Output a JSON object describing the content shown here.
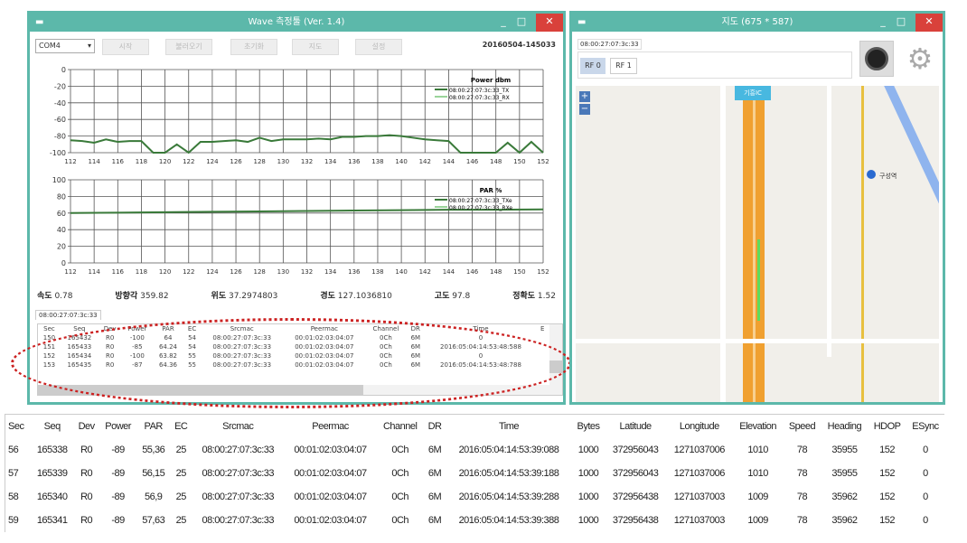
{
  "main_window": {
    "title": "Wave 측정툴 (Ver. 1.4)",
    "port": "COM4",
    "buttons": [
      "시작",
      "불러오기",
      "초기화",
      "지도",
      "설정"
    ],
    "timestamp": "20160504-145033",
    "info": [
      {
        "label": "속도",
        "value": "0.78"
      },
      {
        "label": "방향각",
        "value": "359.82"
      },
      {
        "label": "위도",
        "value": "37.2974803"
      },
      {
        "label": "경도",
        "value": "127.1036810"
      },
      {
        "label": "고도",
        "value": "97.8"
      },
      {
        "label": "정확도",
        "value": "1.52"
      }
    ],
    "tab": "08:00:27:07:3c:33",
    "table": {
      "columns": [
        "Sec",
        "Seq",
        "Dev",
        "Power",
        "PAR",
        "EC",
        "Srcmac",
        "Peermac",
        "Channel",
        "DR",
        "Time",
        "E"
      ],
      "rows": [
        [
          "150",
          "165432",
          "R0",
          "-100",
          "64",
          "54",
          "08:00:27:07:3c:33",
          "00:01:02:03:04:07",
          "0Ch",
          "6M",
          "0",
          ""
        ],
        [
          "151",
          "165433",
          "R0",
          "-85",
          "64.24",
          "54",
          "08:00:27:07:3c:33",
          "00:01:02:03:04:07",
          "0Ch",
          "6M",
          "2016:05:04:14:53:48:588",
          ""
        ],
        [
          "152",
          "165434",
          "R0",
          "-100",
          "63.82",
          "55",
          "08:00:27:07:3c:33",
          "00:01:02:03:04:07",
          "0Ch",
          "6M",
          "0",
          ""
        ],
        [
          "153",
          "165435",
          "R0",
          "-87",
          "64.36",
          "55",
          "08:00:27:07:3c:33",
          "00:01:02:03:04:07",
          "0Ch",
          "6M",
          "2016:05:04:14:53:48:788",
          ""
        ]
      ]
    },
    "highlight_color": "#cc2222"
  },
  "chart_data": [
    {
      "type": "line",
      "title": "Power dbm",
      "xlim": [
        112,
        152
      ],
      "ylim": [
        -100,
        0
      ],
      "xticks": [
        112,
        114,
        116,
        118,
        120,
        122,
        124,
        126,
        128,
        130,
        132,
        134,
        136,
        138,
        140,
        142,
        144,
        146,
        148,
        150,
        152
      ],
      "yticks": [
        0,
        -20,
        -40,
        -60,
        -80,
        -100
      ],
      "grid": true,
      "legend": "top-right",
      "x": [
        112,
        113,
        114,
        115,
        116,
        117,
        118,
        119,
        120,
        121,
        122,
        123,
        124,
        125,
        126,
        127,
        128,
        129,
        130,
        131,
        132,
        133,
        134,
        135,
        136,
        137,
        138,
        139,
        140,
        141,
        142,
        143,
        144,
        145,
        146,
        147,
        148,
        149,
        150,
        151,
        152
      ],
      "series": [
        {
          "name": "08:00:27:07:3c:33_TX",
          "color": "#3a7a3a",
          "values": [
            -85,
            -86,
            -88,
            -84,
            -87,
            -86,
            -86,
            -100,
            -100,
            -90,
            -100,
            -87,
            -87,
            -86,
            -85,
            -87,
            -82,
            -86,
            -84,
            -84,
            -84,
            -83,
            -84,
            -81,
            -81,
            -80,
            -80,
            -79,
            -80,
            -82,
            -84,
            -85,
            -86,
            -100,
            -100,
            -100,
            -100,
            -88,
            -100,
            -87,
            -100
          ]
        },
        {
          "name": "08:00:27:07:3c:33_RX",
          "color": "#9ad49a",
          "values": [
            -85,
            -86,
            -88,
            -84,
            -87,
            -86,
            -86,
            -100,
            -100,
            -90,
            -100,
            -87,
            -87,
            -86,
            -85,
            -87,
            -82,
            -86,
            -84,
            -84,
            -84,
            -83,
            -84,
            -81,
            -81,
            -80,
            -80,
            -79,
            -80,
            -82,
            -84,
            -85,
            -86,
            -100,
            -100,
            -100,
            -100,
            -88,
            -100,
            -87,
            -100
          ]
        }
      ]
    },
    {
      "type": "line",
      "title": "PAR %",
      "xlim": [
        112,
        152
      ],
      "ylim": [
        0,
        100
      ],
      "xticks": [
        112,
        114,
        116,
        118,
        120,
        122,
        124,
        126,
        128,
        130,
        132,
        134,
        136,
        138,
        140,
        142,
        144,
        146,
        148,
        150,
        152
      ],
      "yticks": [
        100,
        80,
        60,
        40,
        20,
        0
      ],
      "grid": true,
      "legend": "top-right",
      "x": [
        112,
        116,
        120,
        124,
        128,
        132,
        136,
        140,
        144,
        148,
        152
      ],
      "series": [
        {
          "name": "08:00:27:07:3c:33_TXe",
          "color": "#3a7a3a",
          "values": [
            60,
            60.5,
            61,
            61.5,
            62,
            62.5,
            63,
            63.5,
            64,
            64,
            64.4
          ]
        },
        {
          "name": "08:00:27:07:3c:33_RXe",
          "color": "#9ad49a",
          "values": [
            60,
            60.5,
            61,
            61.5,
            62,
            62.5,
            63,
            63.5,
            64,
            64,
            64.4
          ]
        }
      ]
    }
  ],
  "map_window": {
    "title": "지도 (675 * 587)",
    "mac": "08:00:27:07:3c:33",
    "rf_buttons": [
      "RF 0",
      "RF 1"
    ],
    "marker_label": "기흥IC",
    "station": "구성역"
  },
  "bottom_table": {
    "columns": [
      "Sec",
      "Seq",
      "Dev",
      "Power",
      "PAR",
      "EC",
      "Srcmac",
      "Peermac",
      "Channel",
      "DR",
      "Time",
      "Bytes",
      "Latitude",
      "Longitude",
      "Elevation",
      "Speed",
      "Heading",
      "HDOP",
      "ESync"
    ],
    "rows": [
      [
        "56",
        "165338",
        "R0",
        "-89",
        "55,36",
        "25",
        "08:00:27:07:3c:33",
        "00:01:02:03:04:07",
        "0Ch",
        "6M",
        "2016:05:04:14:53:39:088",
        "1000",
        "372956043",
        "1271037006",
        "1010",
        "78",
        "35955",
        "152",
        "0"
      ],
      [
        "57",
        "165339",
        "R0",
        "-89",
        "56,15",
        "25",
        "08:00:27:07:3c:33",
        "00:01:02:03:04:07",
        "0Ch",
        "6M",
        "2016:05:04:14:53:39:188",
        "1000",
        "372956043",
        "1271037006",
        "1010",
        "78",
        "35955",
        "152",
        "0"
      ],
      [
        "58",
        "165340",
        "R0",
        "-89",
        "56,9",
        "25",
        "08:00:27:07:3c:33",
        "00:01:02:03:04:07",
        "0Ch",
        "6M",
        "2016:05:04:14:53:39:288",
        "1000",
        "372956438",
        "1271037003",
        "1009",
        "78",
        "35962",
        "152",
        "0"
      ],
      [
        "59",
        "165341",
        "R0",
        "-89",
        "57,63",
        "25",
        "08:00:27:07:3c:33",
        "00:01:02:03:04:07",
        "0Ch",
        "6M",
        "2016:05:04:14:53:39:388",
        "1000",
        "372956438",
        "1271037003",
        "1009",
        "78",
        "35962",
        "152",
        "0"
      ]
    ]
  }
}
